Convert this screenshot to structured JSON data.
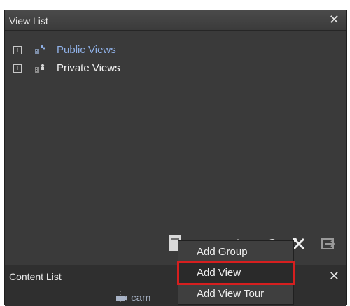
{
  "view_list": {
    "title": "View List",
    "close_glyph": "✕",
    "items": [
      {
        "label": "Public Views",
        "expanded": false,
        "icon": "grid-public-icon"
      },
      {
        "label": "Private Views",
        "expanded": false,
        "icon": "grid-private-icon"
      }
    ]
  },
  "toolbar": {
    "icons": [
      "new-view-icon",
      "group-icon",
      "undo-icon",
      "tools-icon",
      "export-icon"
    ]
  },
  "context_menu": {
    "items": [
      {
        "label": "Add Group"
      },
      {
        "label": "Add View",
        "highlighted": true
      },
      {
        "label": "Add View Tour"
      }
    ]
  },
  "content_list": {
    "title": "Content List",
    "close_glyph": "✕",
    "row_label": "cam"
  },
  "colors": {
    "background": "#3a3a3a",
    "link_blue": "#8fb0e6",
    "highlight_red": "#d61f1f"
  }
}
